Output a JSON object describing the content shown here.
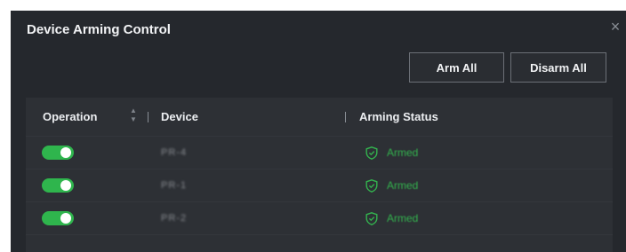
{
  "dialog": {
    "title": "Device Arming Control",
    "close_icon": "close-icon"
  },
  "toolbar": {
    "arm_all_label": "Arm All",
    "disarm_all_label": "Disarm All"
  },
  "table": {
    "columns": [
      "Operation",
      "Device",
      "Arming Status"
    ],
    "sort_icon": "sort-icon",
    "rows": [
      {
        "operation_on": true,
        "device": "PR-4",
        "status": "Armed",
        "status_icon": "shield-icon"
      },
      {
        "operation_on": true,
        "device": "PR-1",
        "status": "Armed",
        "status_icon": "shield-icon"
      },
      {
        "operation_on": true,
        "device": "PR-2",
        "status": "Armed",
        "status_icon": "shield-icon"
      }
    ]
  },
  "colors": {
    "dialog_bg": "#25282d",
    "toggle_on": "#2fb54d",
    "armed": "#33b24e"
  }
}
